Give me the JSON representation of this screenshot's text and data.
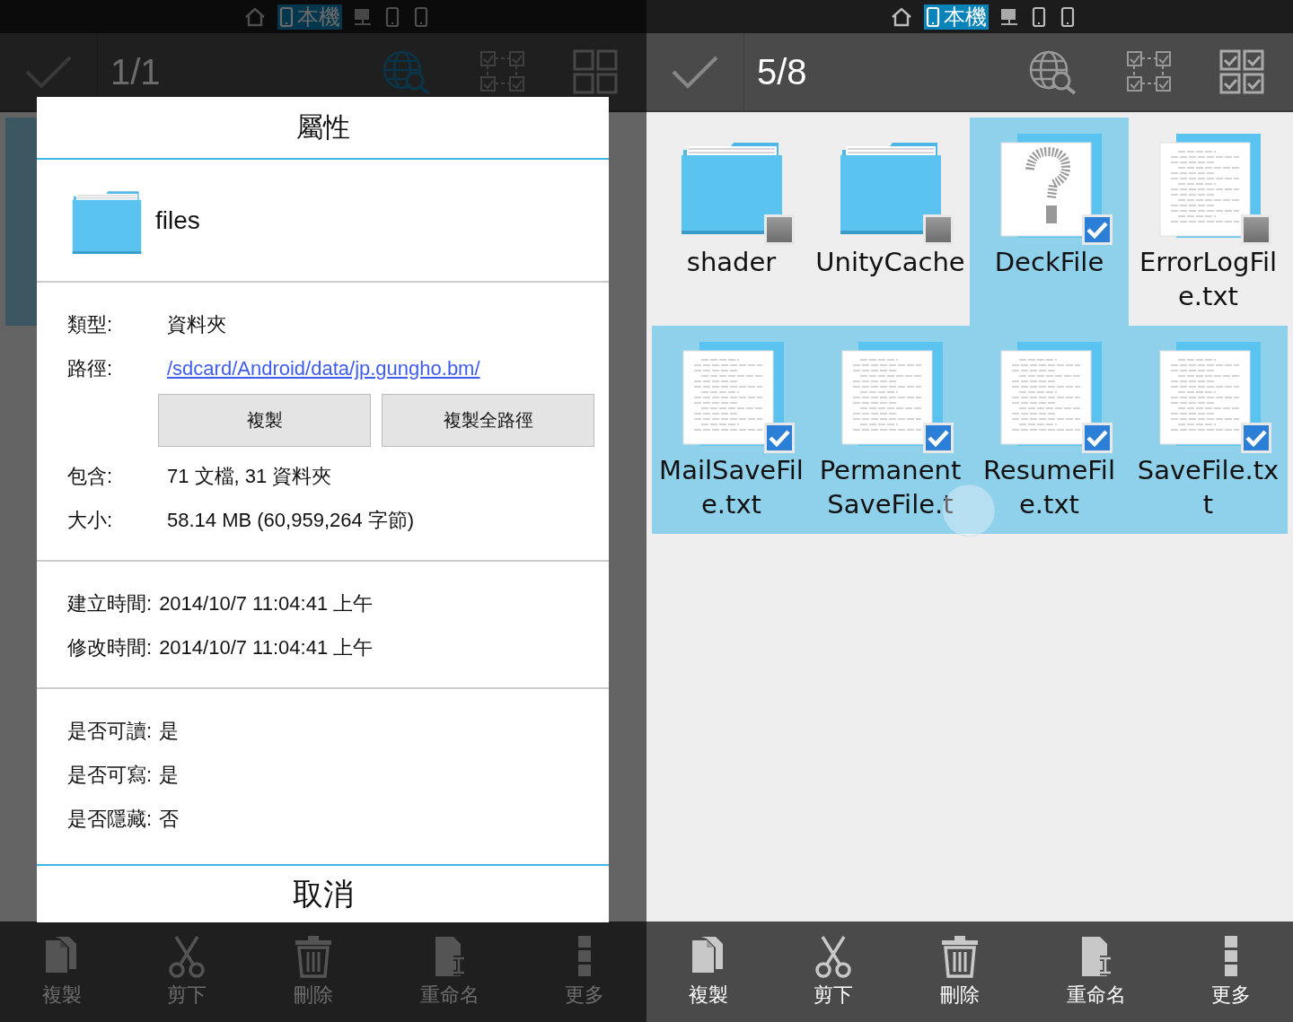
{
  "left": {
    "status_tabs": [
      {
        "kind": "home",
        "selected": false
      },
      {
        "kind": "device",
        "label": "本機",
        "selected": true
      },
      {
        "kind": "network",
        "selected": false
      },
      {
        "kind": "device",
        "selected": false
      },
      {
        "kind": "device",
        "selected": false
      }
    ],
    "toolbar": {
      "count": "1/1",
      "search_active": true,
      "all_selected": false
    },
    "background_tiles": [
      {
        "selected": true
      }
    ],
    "dialog": {
      "title": "屬性",
      "header": {
        "kind": "folder",
        "name": "files"
      },
      "sections": [
        {
          "rows": [
            {
              "kind": "field",
              "label": "類型:",
              "value": "資料夾"
            },
            {
              "kind": "link",
              "label": "路徑:",
              "value": "/sdcard/Android/data/jp.gungho.bm/"
            },
            {
              "kind": "buttons",
              "buttons": [
                "複製",
                "複製全路徑"
              ]
            },
            {
              "kind": "field",
              "label": "包含:",
              "value": "71 文檔, 31 資料夾"
            },
            {
              "kind": "field",
              "label": "大小:",
              "value": "58.14 MB (60,959,264 字節)"
            }
          ]
        },
        {
          "rows": [
            {
              "kind": "inline",
              "label": "建立時間:",
              "value": "2014/10/7 11:04:41 上午"
            },
            {
              "kind": "inline",
              "label": "修改時間:",
              "value": "2014/10/7 11:04:41 上午"
            }
          ]
        },
        {
          "rows": [
            {
              "kind": "inline",
              "label": "是否可讀:",
              "value": "是"
            },
            {
              "kind": "inline",
              "label": "是否可寫:",
              "value": "是"
            },
            {
              "kind": "inline",
              "label": "是否隱藏:",
              "value": "否"
            }
          ]
        }
      ],
      "cancel": "取消"
    },
    "actions": [
      {
        "kind": "copy",
        "label": "複製"
      },
      {
        "kind": "cut",
        "label": "剪下"
      },
      {
        "kind": "delete",
        "label": "刪除"
      },
      {
        "kind": "rename",
        "label": "重命名"
      },
      {
        "kind": "more",
        "label": "更多"
      }
    ]
  },
  "right": {
    "status_tabs": [
      {
        "kind": "home",
        "selected": false
      },
      {
        "kind": "device",
        "label": "本機",
        "selected": true
      },
      {
        "kind": "network",
        "selected": false
      },
      {
        "kind": "device",
        "selected": false
      },
      {
        "kind": "device",
        "selected": false
      }
    ],
    "toolbar": {
      "count": "5/8",
      "search_active": false,
      "all_selected": true
    },
    "files": [
      {
        "kind": "folder",
        "name": "shader",
        "selected": false
      },
      {
        "kind": "folder",
        "name": "UnityCache",
        "selected": false
      },
      {
        "kind": "unknown",
        "name": "DeckFile",
        "selected": true
      },
      {
        "kind": "text",
        "name": "ErrorLogFile.txt",
        "selected": false
      },
      {
        "kind": "text",
        "name": "MailSaveFile.txt",
        "selected": true
      },
      {
        "kind": "text",
        "name": "PermanentSaveFile.t",
        "selected": true
      },
      {
        "kind": "text",
        "name": "ResumeFile.txt",
        "selected": true
      },
      {
        "kind": "text",
        "name": "SaveFile.txt",
        "selected": true
      }
    ],
    "actions": [
      {
        "kind": "copy",
        "label": "複製"
      },
      {
        "kind": "cut",
        "label": "剪下"
      },
      {
        "kind": "delete",
        "label": "刪除"
      },
      {
        "kind": "rename",
        "label": "重命名"
      },
      {
        "kind": "more",
        "label": "更多"
      }
    ]
  }
}
